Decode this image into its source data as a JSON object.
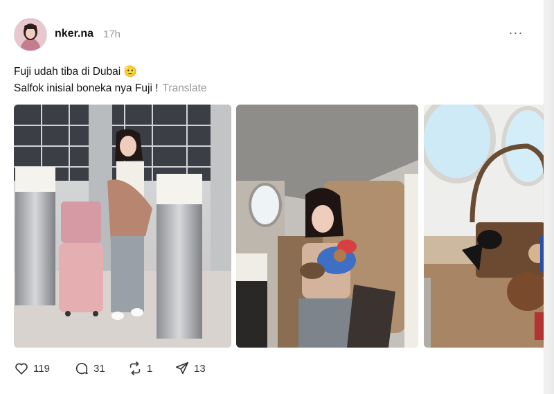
{
  "post": {
    "username": "nker.na",
    "timestamp": "17h",
    "more_label": "···",
    "caption": {
      "line1": "Fuji udah tiba di Dubai 🫡",
      "line2": "Salfok inisial boneka nya Fuji !",
      "translate": "Translate"
    },
    "media": [
      {
        "description": "airport-photo"
      },
      {
        "description": "cabin-seat-photo"
      },
      {
        "description": "window-bag-photo"
      }
    ],
    "actions": {
      "likes": "119",
      "replies": "31",
      "reposts": "1",
      "shares": "13"
    }
  },
  "icons": {
    "like": "heart-icon",
    "reply": "speech-bubble-icon",
    "repost": "repost-icon",
    "share": "send-icon",
    "more": "ellipsis-icon"
  },
  "colors": {
    "text": "#111111",
    "muted": "#999999",
    "icon": "#333333"
  }
}
